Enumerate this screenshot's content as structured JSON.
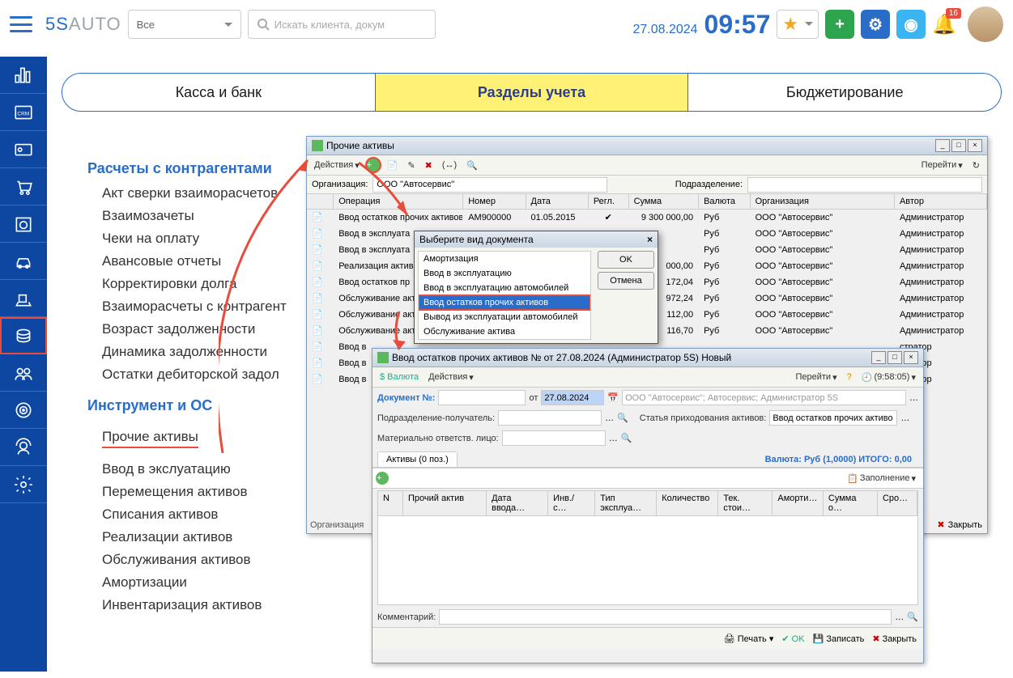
{
  "header": {
    "logo_main": "5S",
    "logo_sub": "AUTO",
    "scope_dropdown": "Все",
    "search_placeholder": "Искать клиента, докум",
    "date": "27.08.2024",
    "time": "09:57",
    "notification_count": "16"
  },
  "tabs": [
    "Касса и банк",
    "Разделы учета",
    "Бюджетирование"
  ],
  "active_tab": 1,
  "sections": [
    {
      "title": "Расчеты с контрагентами",
      "items": [
        "Акт сверки взаиморасчетов",
        "Взаимозачеты",
        "Чеки на оплату",
        "Авансовые отчеты",
        "Корректировки долга",
        "Взаиморасчеты с контрагент",
        "Возраст задолженности",
        "Динамика задолженности",
        "Остатки дебиторской задол"
      ]
    },
    {
      "title": "Инструмент и ОС",
      "items": [
        "Прочие активы",
        "Ввод в экслуатацию",
        "Перемещения активов",
        "Списания активов",
        "Реализации активов",
        "Обслуживания активов",
        "Амортизации",
        "Инвентаризация активов"
      ]
    }
  ],
  "win1": {
    "title": "Прочие активы",
    "actions_label": "Действия",
    "goto_label": "Перейти",
    "org_label": "Организация:",
    "org_value": "ООО \"Автосервис\"",
    "dept_label": "Подразделение:",
    "columns": [
      "Операция",
      "Номер",
      "Дата",
      "Регл.",
      "Сумма",
      "Валюта",
      "Организация",
      "Автор"
    ],
    "rows": [
      {
        "op": "Ввод остатков прочих активов",
        "num": "AM900000",
        "date": "01.05.2015",
        "reg": "✔",
        "sum": "9 300 000,00",
        "cur": "Руб",
        "org": "ООО \"Автосервис\"",
        "auth": "Администратор "
      },
      {
        "op": "Ввод в эксплуата",
        "num": "",
        "date": "",
        "reg": "",
        "sum": "",
        "cur": "Руб",
        "org": "ООО \"Автосервис\"",
        "auth": "Администратор "
      },
      {
        "op": "Ввод в эксплуата",
        "num": "",
        "date": "",
        "reg": "",
        "sum": "",
        "cur": "Руб",
        "org": "ООО \"Автосервис\"",
        "auth": "Администратор "
      },
      {
        "op": "Реализация актив",
        "num": "",
        "date": "",
        "reg": "",
        "sum": "000,00",
        "cur": "Руб",
        "org": "ООО \"Автосервис\"",
        "auth": "Администратор "
      },
      {
        "op": "Ввод остатков пр",
        "num": "",
        "date": "",
        "reg": "",
        "sum": "172,04",
        "cur": "Руб",
        "org": "ООО \"Автосервис\"",
        "auth": "Администратор "
      },
      {
        "op": "Обслуживание акт",
        "num": "",
        "date": "",
        "reg": "",
        "sum": "972,24",
        "cur": "Руб",
        "org": "ООО \"Автосервис\"",
        "auth": "Администратор "
      },
      {
        "op": "Обслуживание акт",
        "num": "",
        "date": "",
        "reg": "",
        "sum": "112,00",
        "cur": "Руб",
        "org": "ООО \"Автосервис\"",
        "auth": "Администратор "
      },
      {
        "op": "Обслуживание акт",
        "num": "",
        "date": "",
        "reg": "",
        "sum": "116,70",
        "cur": "Руб",
        "org": "ООО \"Автосервис\"",
        "auth": "Администратор "
      },
      {
        "op": "Ввод в",
        "num": "",
        "date": "",
        "reg": "",
        "sum": "",
        "cur": "",
        "org": "",
        "auth": "стратор "
      },
      {
        "op": "Ввод в",
        "num": "",
        "date": "",
        "reg": "",
        "sum": "",
        "cur": "",
        "org": "",
        "auth": "стратор "
      },
      {
        "op": "Ввод в",
        "num": "",
        "date": "",
        "reg": "",
        "sum": "",
        "cur": "",
        "org": "",
        "auth": "стратор "
      }
    ],
    "org_status": "Организация",
    "close_label": "Закрыть"
  },
  "modal": {
    "title": "Выберите вид документа",
    "items": [
      "Амортизация",
      "Ввод в эксплуатацию",
      "Ввод в эксплуатацию автомобилей",
      "Ввод остатков прочих активов",
      "Вывод из эксплуатации автомобилей",
      "Обслуживание актива"
    ],
    "selected": 3,
    "ok": "OK",
    "cancel": "Отмена"
  },
  "win2": {
    "title": "Ввод остатков прочих активов №  от 27.08.2024 (Администратор 5S) Новый",
    "currency_label": "$ Валюта",
    "actions_label": "Действия",
    "goto_label": "Перейти",
    "time_btn": "(9:58:05)",
    "doc_label": "Документ №:",
    "from_label": "от",
    "doc_date": "27.08.2024",
    "context": "ООО \"Автосервис\"; Автосервис; Администратор 5S",
    "dept_label": "Подразделение-получатель:",
    "article_label": "Статья приходования активов:",
    "article_value": "Ввод остатков прочих активо",
    "mol_label": "Материально ответств. лицо:",
    "tab_label": "Активы (0 поз.)",
    "totals": "Валюта: Руб (1,0000) ИТОГО: 0,00",
    "fill_label": "Заполнение",
    "grid_cols": [
      "N",
      "Прочий актив",
      "Дата ввода…",
      "Инв./ с…",
      "Тип эксплуа…",
      "Количество",
      "Тек. стои…",
      "Аморти…",
      "Сумма о…",
      "Сро…"
    ],
    "comment_label": "Комментарий:",
    "print_label": "Печать",
    "ok": "OK",
    "save": "Записать",
    "close": "Закрыть"
  }
}
